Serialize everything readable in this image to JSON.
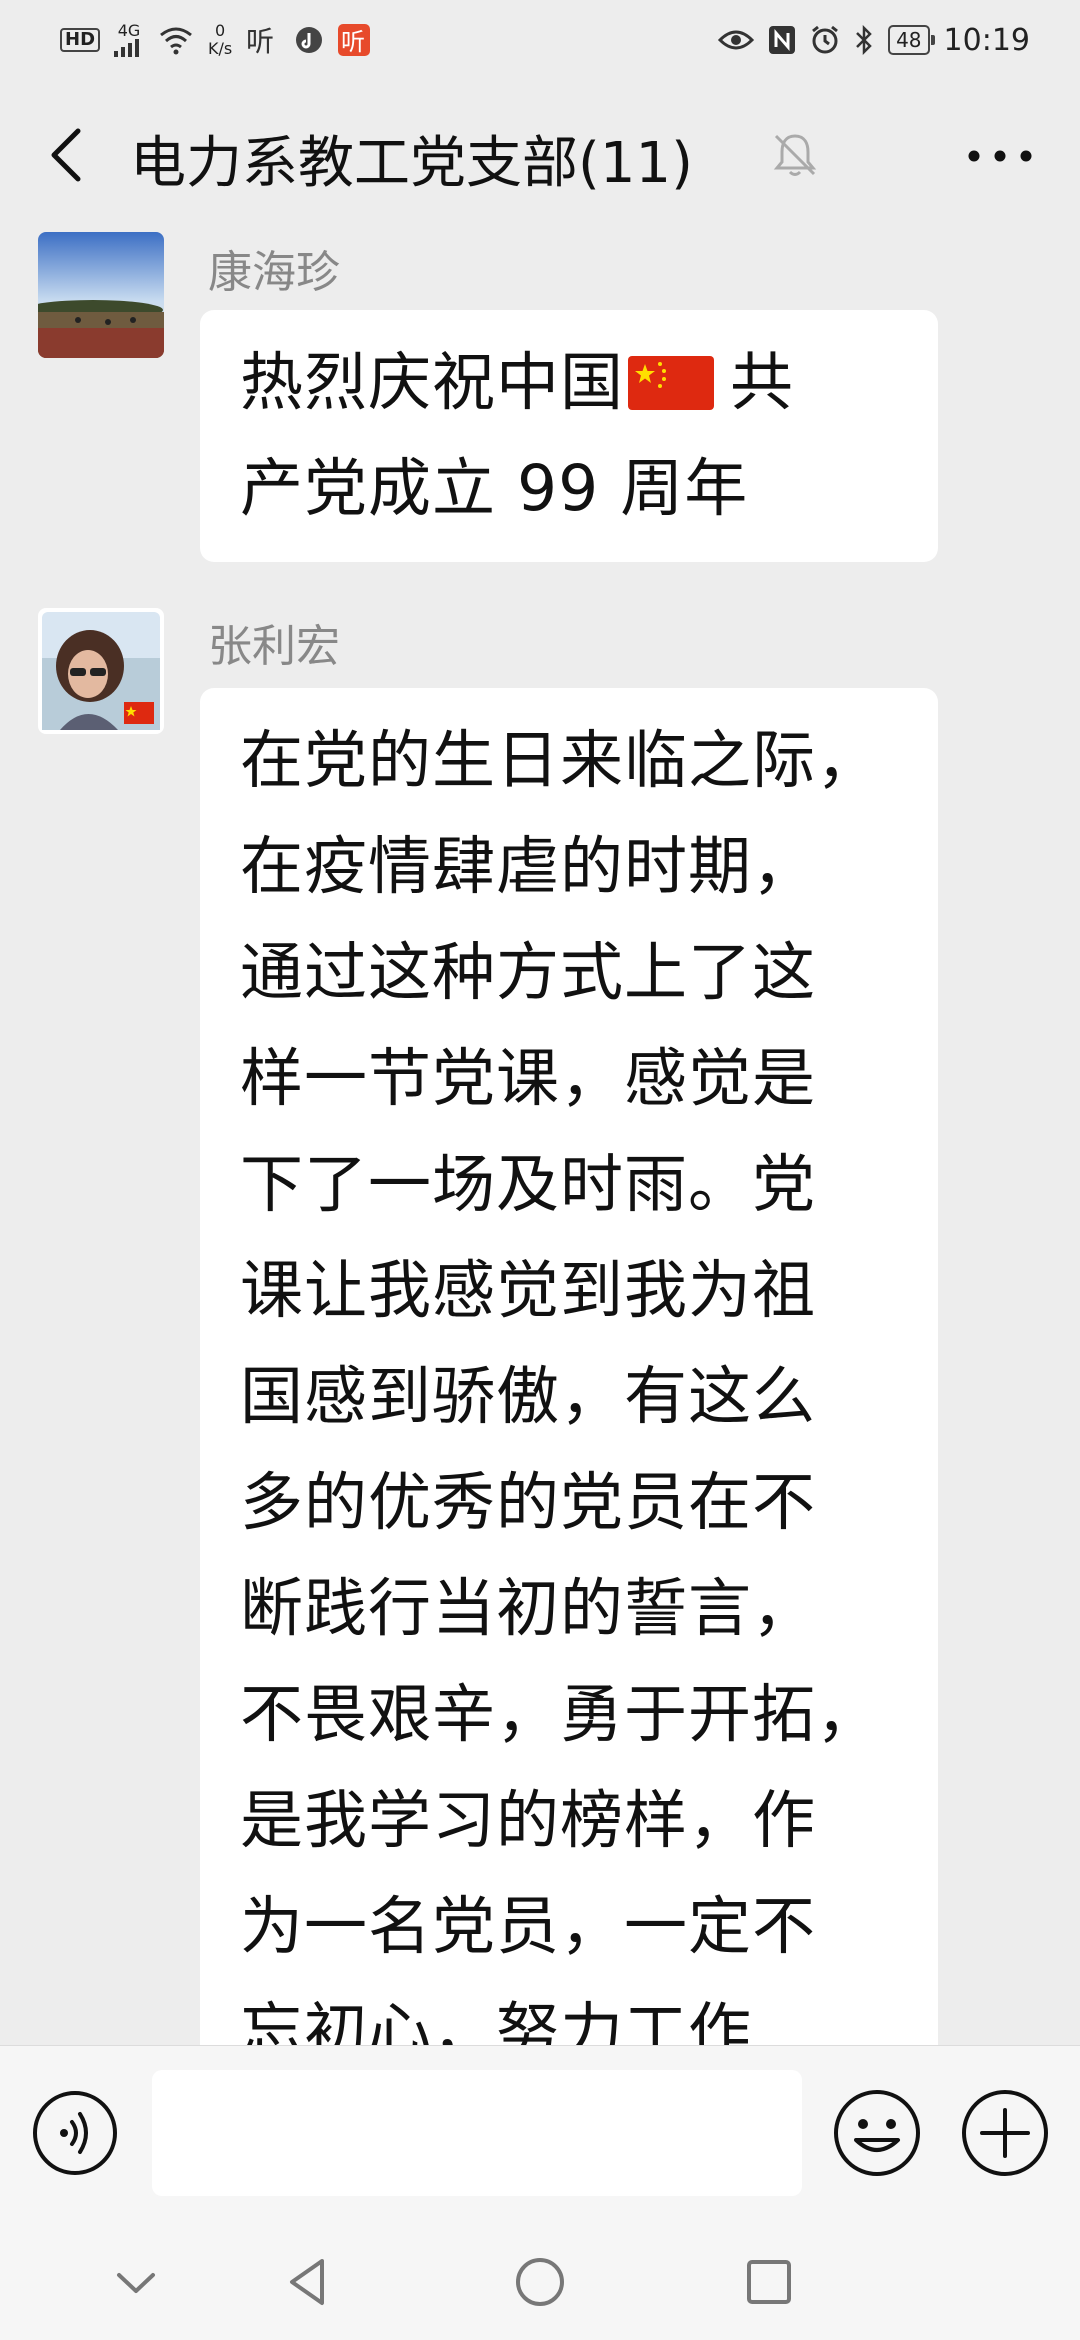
{
  "status_bar": {
    "hd": "HD",
    "network": "4G",
    "speed_value": "0",
    "speed_unit": "K/s",
    "battery": "48",
    "time": "10:19",
    "icons": [
      "hd-icon",
      "signal-icon",
      "wifi-icon",
      "music-icon",
      "tiktok-icon",
      "app-red-icon",
      "eye-icon",
      "nfc-icon",
      "alarm-icon",
      "bluetooth-icon",
      "battery-icon"
    ]
  },
  "header": {
    "title": "电力系教工党支部(11)",
    "icons": [
      "back-icon",
      "mute-bell-icon",
      "more-icon"
    ]
  },
  "messages": [
    {
      "sender": "康海珍",
      "lines": [
        "热烈庆祝中国",
        "共",
        "产党成立 99 周年"
      ]
    },
    {
      "sender": "张利宏",
      "lines": [
        "在党的生日来临之际，",
        "在疫情肆虐的时期，",
        "通过这种方式上了这",
        "样一节党课，感觉是",
        "下了一场及时雨。党",
        "课让我感觉到我为祖",
        "国感到骄傲，有这么",
        "多的优秀的党员在不",
        "断践行当初的誓言，",
        "不畏艰辛，勇于开拓，",
        "是我学习的榜样，作",
        "为一名党员，一定不",
        "忘初心，努力工作"
      ]
    }
  ],
  "input_bar": {
    "placeholder": "",
    "icons": [
      "voice-icon",
      "emoji-icon",
      "plus-icon"
    ]
  },
  "nav_bar": {
    "icons": [
      "collapse-icon",
      "back-triangle-icon",
      "home-circle-icon",
      "recents-square-icon"
    ]
  },
  "colors": {
    "background": "#ededed",
    "bubble": "#ffffff",
    "sender": "#888888",
    "flag_red": "#de2910",
    "flag_star": "#ffde00"
  }
}
